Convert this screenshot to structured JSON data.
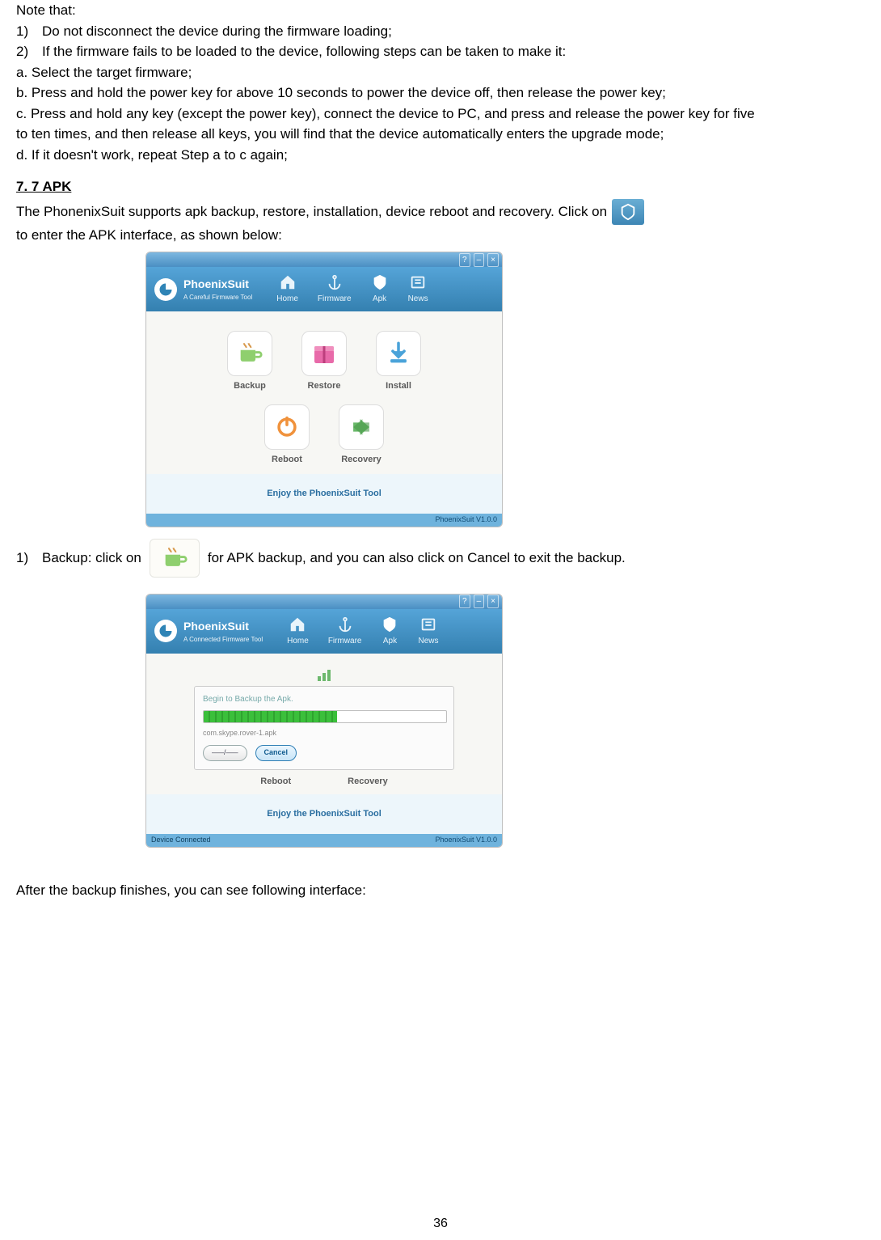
{
  "notes": {
    "intro": "Note that:",
    "item1": "Do not disconnect the device during the firmware loading;",
    "item2": "If the firmware fails to be loaded to the device, following steps can be taken to make it:",
    "steps": {
      "a": "a. Select the target firmware;",
      "b": "b. Press and hold the power key for above 10 seconds to power the device off, then release the power key;",
      "c": "c. Press and hold any key (except the power key), connect the device to PC, and press and release the power key for five to ten times, and then release all keys, you will find that the device automatically enters the upgrade mode;",
      "d": "d. If it doesn't work, repeat Step a to c again;"
    }
  },
  "section": {
    "title": "7. 7 APK",
    "text_before_icon": "The PhonenixSuit supports apk backup, restore, installation, device reboot and recovery. Click on",
    "text_after_icon": "to enter the APK interface, as shown below:"
  },
  "screenshot1": {
    "brand": "PhoenixSuit",
    "brand_sub": "A Careful Firmware Tool",
    "nav": {
      "home": "Home",
      "firmware": "Firmware",
      "apk": "Apk",
      "news": "News"
    },
    "icons": {
      "backup": "Backup",
      "restore": "Restore",
      "install": "Install",
      "reboot": "Reboot",
      "recovery": "Recovery"
    },
    "footer_text": "Enjoy the PhoenixSuit Tool",
    "version": "PhoenixSuit V1.0.0"
  },
  "backup_line": {
    "num": "1)",
    "text_before": "Backup: click on",
    "text_after": "for APK backup, and you can also click on Cancel to exit the backup."
  },
  "screenshot2": {
    "brand": "PhoenixSuit",
    "brand_sub": "A Connected Firmware Tool",
    "nav": {
      "home": "Home",
      "firmware": "Firmware",
      "apk": "Apk",
      "news": "News"
    },
    "progress_title": "Begin to Backup the Apk.",
    "progress_file": "com.skype.rover-1.apk",
    "buttons": {
      "count": "–––/–––",
      "cancel": "Cancel"
    },
    "bottom": {
      "reboot": "Reboot",
      "recovery": "Recovery"
    },
    "footer_text": "Enjoy the PhoenixSuit Tool",
    "status": "Device Connected",
    "version": "PhoenixSuit V1.0.0"
  },
  "after_backup_text": "After the backup finishes, you can see following interface:",
  "page_number": "36"
}
